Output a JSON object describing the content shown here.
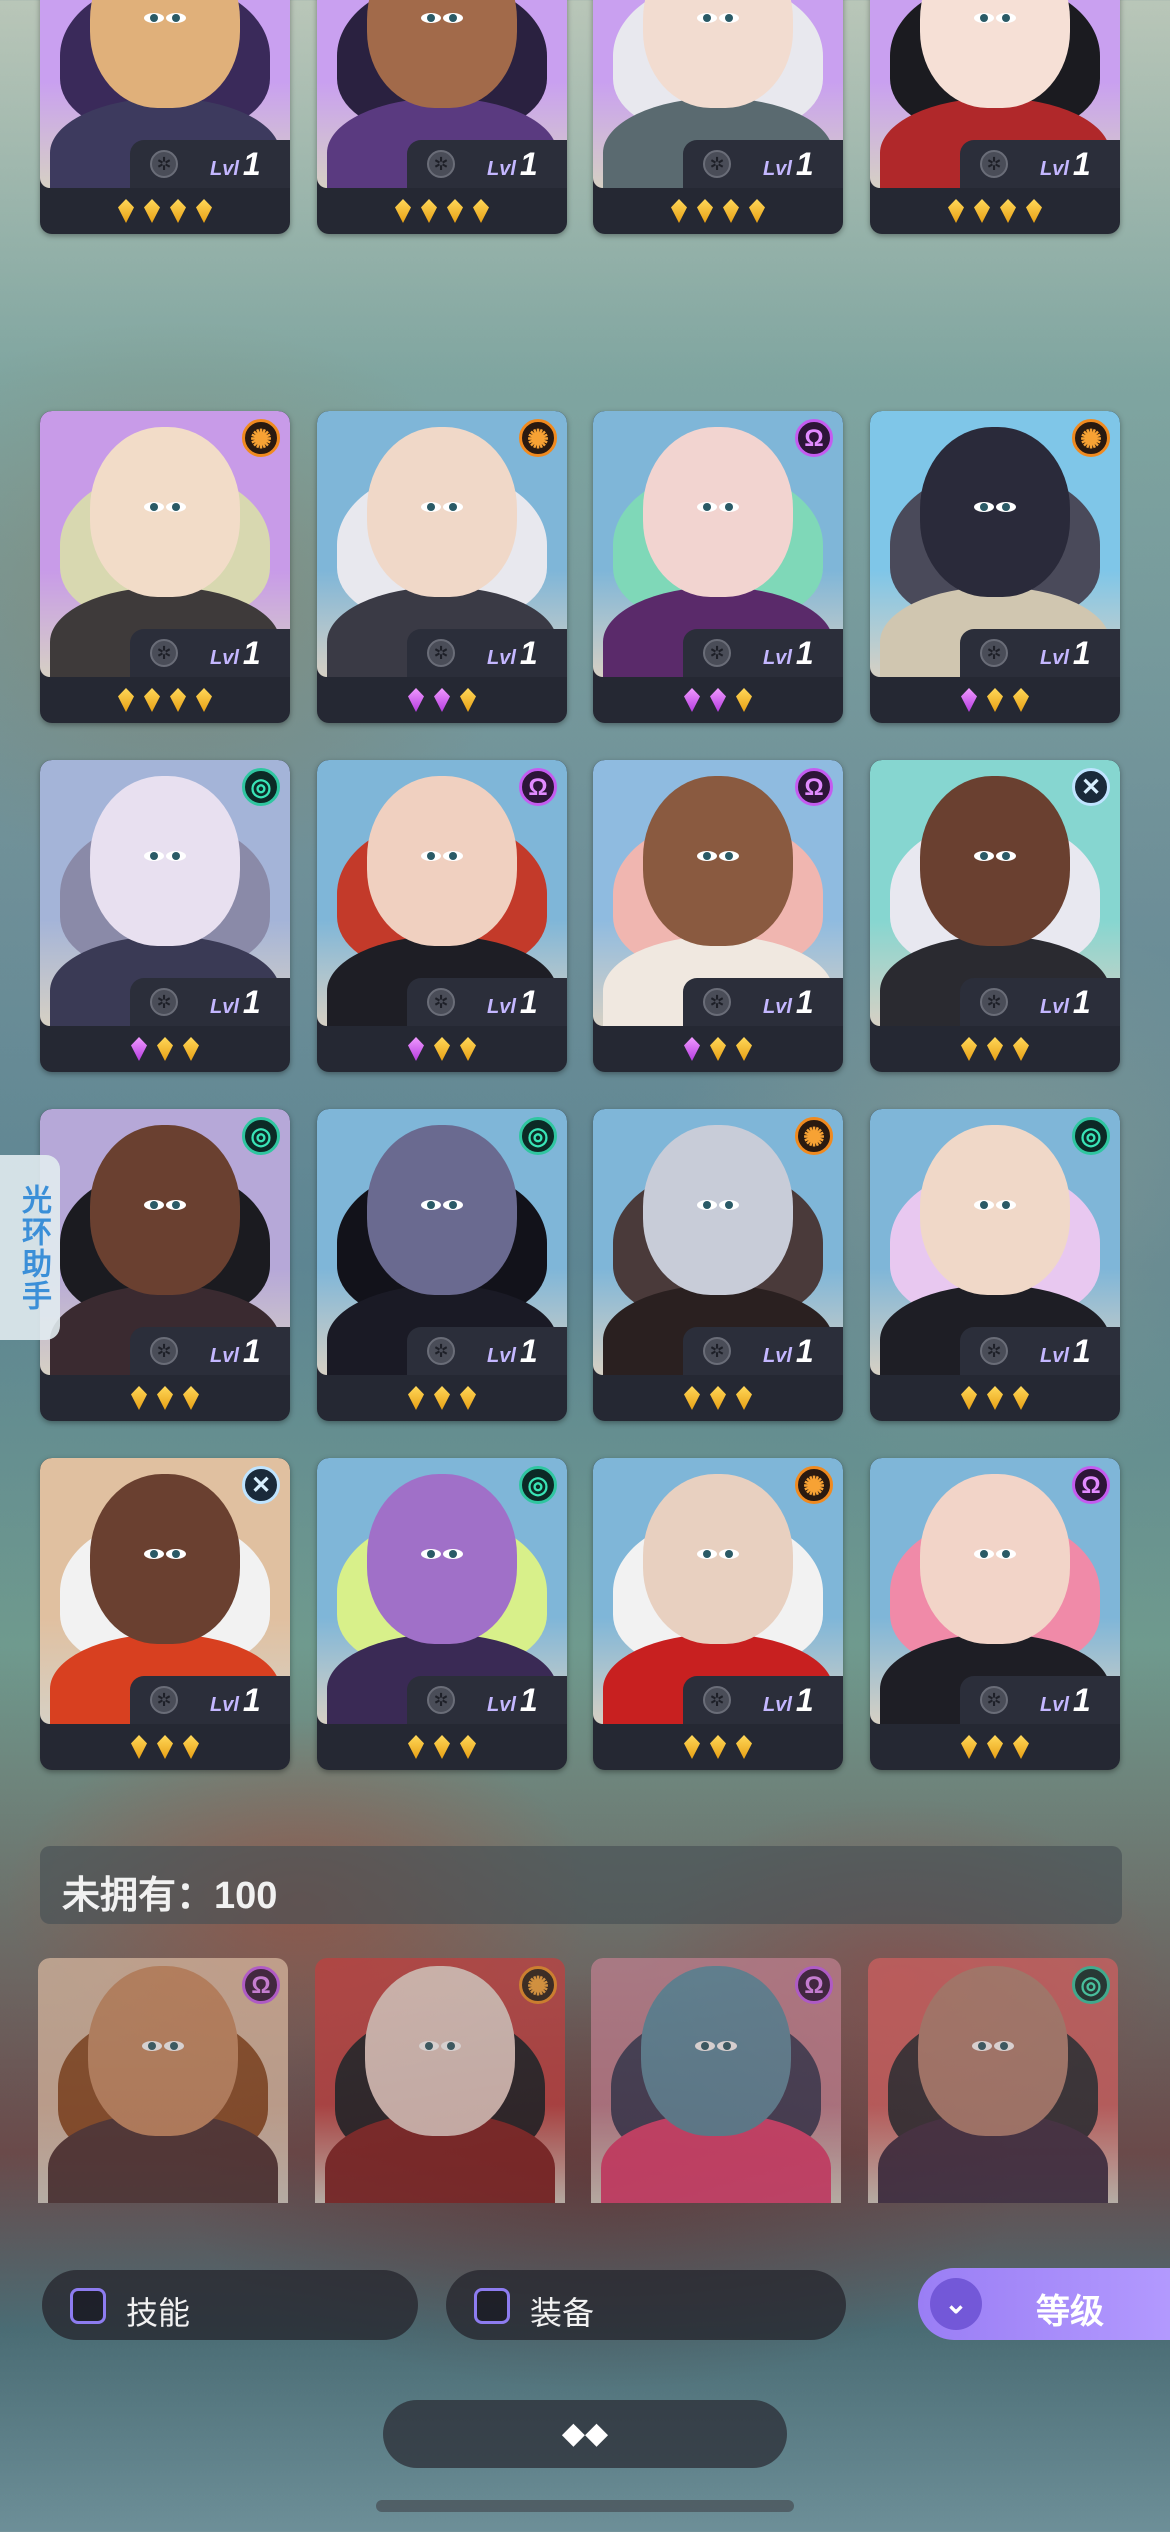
{
  "side_tab_label": "光环助手",
  "unowned_label": "未拥有：100",
  "filters": {
    "skill_label": "技能",
    "equip_label": "装备"
  },
  "sort": {
    "label": "等级"
  },
  "bottom_icon": "expand-diamonds-icon",
  "level_prefix": "Lvl",
  "owned_heroes": [
    {
      "level": "1",
      "element": "none",
      "gems": [
        "g",
        "g",
        "g",
        "g"
      ],
      "palette": [
        "#c9a0f0",
        "#3a2a5a",
        "#e0b07a",
        "#3d3a5e"
      ]
    },
    {
      "level": "1",
      "element": "none",
      "gems": [
        "g",
        "g",
        "g",
        "g"
      ],
      "palette": [
        "#c9a0f0",
        "#2a2140",
        "#a26a4a",
        "#5a3a80"
      ]
    },
    {
      "level": "1",
      "element": "none",
      "gems": [
        "g",
        "g",
        "g",
        "g"
      ],
      "palette": [
        "#c9a0f0",
        "#e8e8ee",
        "#f2dcd0",
        "#5a6a70"
      ]
    },
    {
      "level": "1",
      "element": "none",
      "gems": [
        "g",
        "g",
        "g",
        "g"
      ],
      "palette": [
        "#c9a0f0",
        "#1b1b20",
        "#f6e0d6",
        "#b0282a"
      ]
    },
    {
      "level": "1",
      "element": "sun",
      "gems": [
        "g",
        "g",
        "g",
        "g"
      ],
      "palette": [
        "#c89be8",
        "#d8d8b0",
        "#f2dcc8",
        "#3e3a3a"
      ]
    },
    {
      "level": "1",
      "element": "sun",
      "gems": [
        "p",
        "p",
        "g"
      ],
      "palette": [
        "#7fb6d8",
        "#e8e8ee",
        "#f0d8c8",
        "#3a3a45"
      ]
    },
    {
      "level": "1",
      "element": "omega",
      "gems": [
        "p",
        "p",
        "g"
      ],
      "palette": [
        "#7fb6d8",
        "#7fd8b8",
        "#f2d4d0",
        "#5a2a6a"
      ]
    },
    {
      "level": "1",
      "element": "sun",
      "gems": [
        "p",
        "g",
        "g"
      ],
      "palette": [
        "#7fc6e8",
        "#4a4a5a",
        "#2a2a3a",
        "#d0c6b0"
      ]
    },
    {
      "level": "1",
      "element": "swirl",
      "gems": [
        "p",
        "g",
        "g"
      ],
      "palette": [
        "#a4b4d8",
        "#8a8aa8",
        "#e8e0f0",
        "#3a3a55"
      ]
    },
    {
      "level": "1",
      "element": "omega",
      "gems": [
        "p",
        "g",
        "g"
      ],
      "palette": [
        "#7fb6d8",
        "#c33a2a",
        "#f0d0c0",
        "#1e1e25"
      ]
    },
    {
      "level": "1",
      "element": "omega",
      "gems": [
        "p",
        "g",
        "g"
      ],
      "palette": [
        "#8fbbe0",
        "#f0b6b0",
        "#8a5a40",
        "#f0e8e0"
      ]
    },
    {
      "level": "1",
      "element": "cross",
      "gems": [
        "g",
        "g",
        "g"
      ],
      "palette": [
        "#86d6d0",
        "#e8e8f0",
        "#6a4030",
        "#2a2a30"
      ]
    },
    {
      "level": "1",
      "element": "swirl",
      "gems": [
        "g",
        "g",
        "g"
      ],
      "palette": [
        "#b6a8d8",
        "#1b1b20",
        "#6a4030",
        "#3a2a30"
      ]
    },
    {
      "level": "1",
      "element": "swirl",
      "gems": [
        "g",
        "g",
        "g"
      ],
      "palette": [
        "#7fb6d8",
        "#12121a",
        "#6a6a90",
        "#1a1a25"
      ]
    },
    {
      "level": "1",
      "element": "sun",
      "gems": [
        "g",
        "g",
        "g"
      ],
      "palette": [
        "#7fb6d8",
        "#4a3a3a",
        "#c8ccd8",
        "#2a2020"
      ]
    },
    {
      "level": "1",
      "element": "swirl",
      "gems": [
        "g",
        "g",
        "g"
      ],
      "palette": [
        "#7fb6d8",
        "#e8c8f0",
        "#f0d8c8",
        "#1e1e25"
      ]
    },
    {
      "level": "1",
      "element": "cross",
      "gems": [
        "g",
        "g",
        "g"
      ],
      "palette": [
        "#e0c0a0",
        "#f2f2f2",
        "#6a4030",
        "#d84020"
      ]
    },
    {
      "level": "1",
      "element": "swirl",
      "gems": [
        "g",
        "g",
        "g"
      ],
      "palette": [
        "#7fb6d8",
        "#d8f08a",
        "#a070c8",
        "#3a2a55"
      ]
    },
    {
      "level": "1",
      "element": "sun",
      "gems": [
        "g",
        "g",
        "g"
      ],
      "palette": [
        "#7fb6d8",
        "#f2f2f2",
        "#e8d0c0",
        "#c82020"
      ]
    },
    {
      "level": "1",
      "element": "omega",
      "gems": [
        "g",
        "g",
        "g"
      ],
      "palette": [
        "#7fb6d8",
        "#f08aa8",
        "#f2d4c8",
        "#1e1e25"
      ]
    }
  ],
  "unowned_heroes": [
    {
      "element": "omega",
      "palette": [
        "#d8b8a0",
        "#8a4a20",
        "#c88a60",
        "#4a3030"
      ]
    },
    {
      "element": "sun",
      "palette": [
        "#c04040",
        "#1b1b20",
        "#e8d0c8",
        "#802020"
      ]
    },
    {
      "element": "omega",
      "palette": [
        "#c08090",
        "#3a3a55",
        "#5a8aa0",
        "#e04070"
      ]
    },
    {
      "element": "swirl",
      "palette": [
        "#d06060",
        "#2a2a30",
        "#b08070",
        "#3a2a40"
      ]
    }
  ],
  "colors": {
    "accent": "#a58af7",
    "card_bg": "#252833",
    "gold_gem": "#f4c230",
    "purple_gem": "#d35af0"
  }
}
